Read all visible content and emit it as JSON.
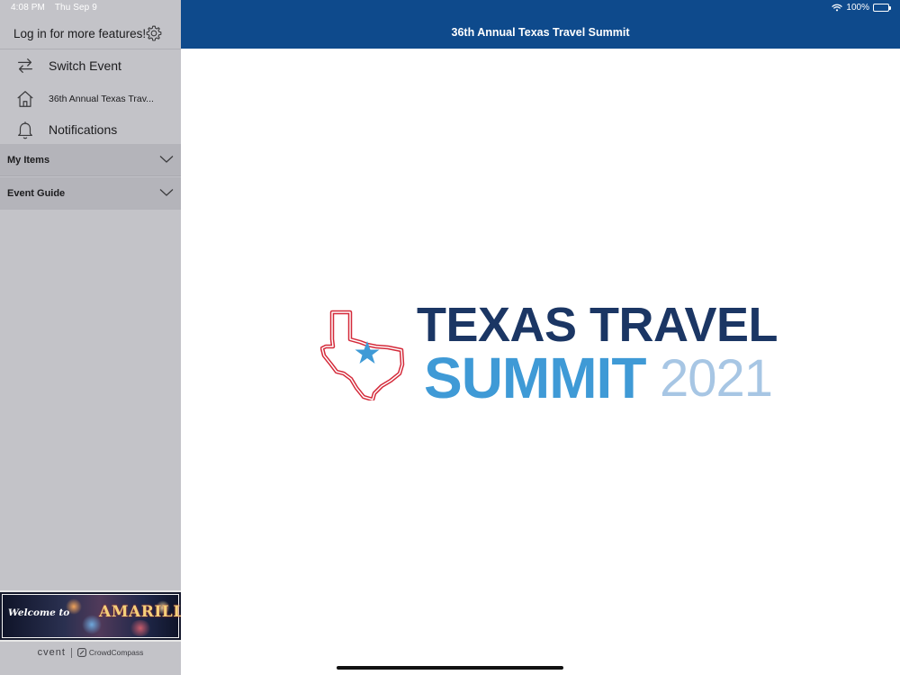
{
  "status_bar": {
    "time": "4:08 PM",
    "date": "Thu Sep 9",
    "battery": "100%"
  },
  "sidebar": {
    "login_prompt": "Log in for more features!",
    "items": [
      {
        "label": "Switch Event",
        "icon": "switch-arrows-icon"
      },
      {
        "label": "36th Annual Texas Trav...",
        "icon": "home-icon"
      },
      {
        "label": "Notifications",
        "icon": "bell-icon"
      }
    ],
    "sections": [
      {
        "label": "My Items",
        "icon": "chevron-down-icon"
      },
      {
        "label": "Event Guide",
        "icon": "chevron-down-icon"
      }
    ],
    "banner": {
      "welcome": "Welcome to",
      "city": "AMARILLO"
    },
    "footer": {
      "brand": "cvent",
      "partner": "CrowdCompass"
    }
  },
  "header": {
    "title": "36th Annual Texas Travel Summit"
  },
  "logo": {
    "line1": "TEXAS TRAVEL",
    "line2": "SUMMIT",
    "year": "2021",
    "colors": {
      "dark_blue": "#1b3664",
      "light_blue": "#3f9ad6",
      "pale_blue": "#a7c6e4",
      "red_outline": "#d42a3a"
    }
  }
}
